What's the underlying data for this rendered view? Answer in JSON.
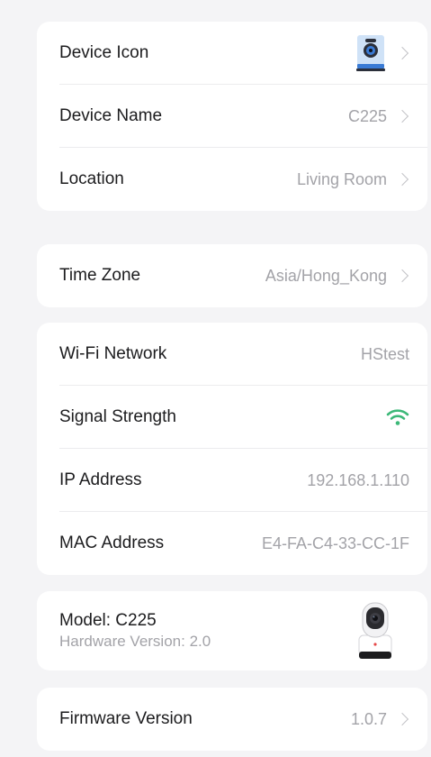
{
  "device_card": {
    "icon_label": "Device Icon",
    "name_label": "Device Name",
    "name_value": "C225",
    "location_label": "Location",
    "location_value": "Living Room"
  },
  "timezone_card": {
    "label": "Time Zone",
    "value": "Asia/Hong_Kong"
  },
  "network_card": {
    "wifi_label": "Wi-Fi Network",
    "wifi_value": "HStest",
    "signal_label": "Signal Strength",
    "signal_icon": "wifi-icon",
    "signal_color": "#3cb878",
    "ip_label": "IP Address",
    "ip_value": "192.168.1.110",
    "mac_label": "MAC Address",
    "mac_value": "E4-FA-C4-33-CC-1F"
  },
  "model_card": {
    "model": "Model: C225",
    "hardware": "Hardware Version: 2.0"
  },
  "firmware_card": {
    "label": "Firmware Version",
    "value": "1.0.7"
  }
}
